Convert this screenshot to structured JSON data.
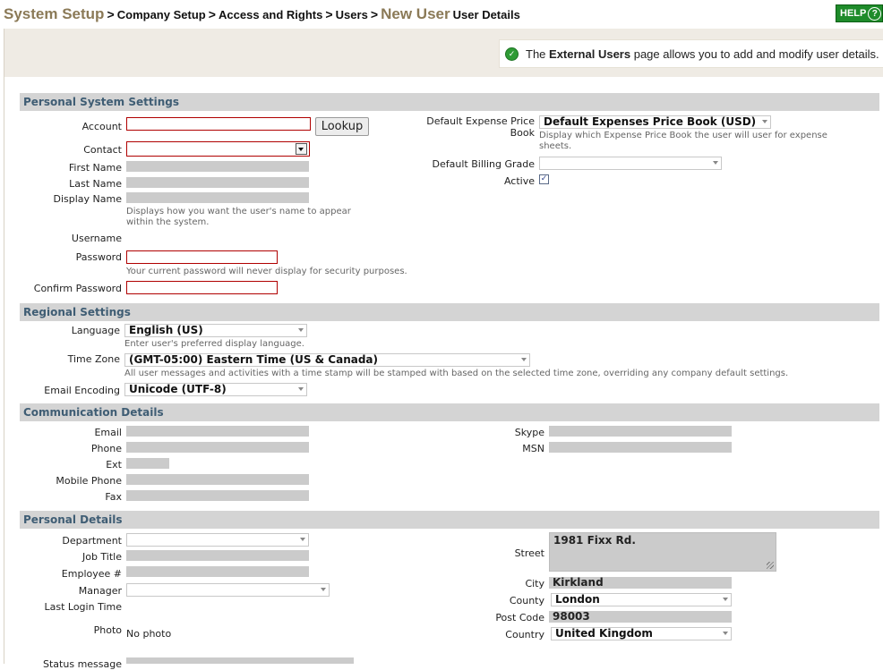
{
  "breadcrumb": {
    "root": "System Setup",
    "sep": ">",
    "items": [
      "Company Setup",
      "Access and Rights",
      "Users"
    ],
    "current": "New User",
    "sub": "User Details"
  },
  "help": {
    "label": "HELP",
    "icon": "help-icon",
    "glyph": "?"
  },
  "info": {
    "prefix": "The",
    "bold": "External Users",
    "suffix": "page allows you to add and modify user details.",
    "icon": "check-icon"
  },
  "sections": {
    "personal_system": "Personal System Settings",
    "regional": "Regional Settings",
    "communication": "Communication Details",
    "personal_details": "Personal Details"
  },
  "personal_system": {
    "account_label": "Account",
    "lookup_label": "Lookup",
    "contact_label": "Contact",
    "first_name_label": "First Name",
    "last_name_label": "Last Name",
    "display_name_label": "Display Name",
    "display_name_hint1": "Displays how you want the user's name to appear",
    "display_name_hint2": "within the system.",
    "username_label": "Username",
    "password_label": "Password",
    "password_hint": "Your current password will never display for security purposes.",
    "confirm_password_label": "Confirm Password",
    "expense_label1": "Default Expense Price",
    "expense_label2": "Book",
    "expense_value": "Default Expenses Price Book (USD)",
    "expense_hint1": "Display which Expense Price Book the user will user for expense",
    "expense_hint2": "sheets.",
    "billing_label": "Default Billing Grade",
    "billing_value": "",
    "active_label": "Active",
    "active_check": "✓"
  },
  "regional": {
    "language_label": "Language",
    "language_value": "English (US)",
    "language_hint": "Enter user's preferred display language.",
    "timezone_label": "Time Zone",
    "timezone_value": "(GMT-05:00) Eastern Time (US & Canada)",
    "timezone_hint": "All user messages and activities with a time stamp will be stamped with based on the selected time zone, overriding any company default settings.",
    "encoding_label": "Email Encoding",
    "encoding_value": "Unicode (UTF-8)"
  },
  "communication": {
    "email_label": "Email",
    "phone_label": "Phone",
    "ext_label": "Ext",
    "mobile_label": "Mobile Phone",
    "fax_label": "Fax",
    "skype_label": "Skype",
    "msn_label": "MSN"
  },
  "personal_details": {
    "department_label": "Department",
    "job_title_label": "Job Title",
    "employee_label": "Employee #",
    "manager_label": "Manager",
    "last_login_label": "Last Login Time",
    "photo_label": "Photo",
    "photo_value": "No photo",
    "status_label": "Status message",
    "street_label": "Street",
    "street_value": "1981 Fixx Rd.",
    "city_label": "City",
    "city_value": "Kirkland",
    "county_label": "County",
    "county_value": "London",
    "postcode_label": "Post Code",
    "postcode_value": "98003",
    "country_label": "Country",
    "country_value": "United Kingdom"
  }
}
